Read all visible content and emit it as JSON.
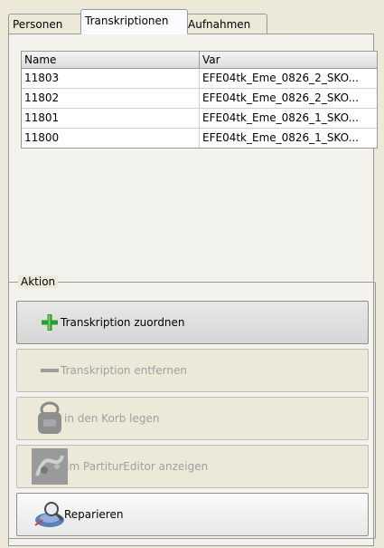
{
  "tabs": {
    "personen": "Personen",
    "transkriptionen": "Transkriptionen",
    "aufnahmen": "Aufnahmen"
  },
  "table": {
    "headers": {
      "name": "Name",
      "var": "Var"
    },
    "rows": [
      {
        "name": "11803",
        "var": "EFE04tk_Eme_0826_2_SKO..."
      },
      {
        "name": "11802",
        "var": "EFE04tk_Eme_0826_2_SKO..."
      },
      {
        "name": "11801",
        "var": "EFE04tk_Eme_0826_1_SKO..."
      },
      {
        "name": "11800",
        "var": "EFE04tk_Eme_0826_1_SKO..."
      }
    ]
  },
  "action": {
    "title": "Aktion",
    "assign": "Transkription zuordnen",
    "remove": "Transkription entfernen",
    "basket": "in den Korb legen",
    "partitur": "Im PartiturEditor anzeigen",
    "repair": "Reparieren"
  },
  "colors": {
    "accent_plus": "#2e9b2e",
    "disabled_text": "#a0a0a0"
  },
  "icons": [
    "plus-icon",
    "minus-icon",
    "basket-icon",
    "partitur-icon",
    "repair-icon"
  ]
}
